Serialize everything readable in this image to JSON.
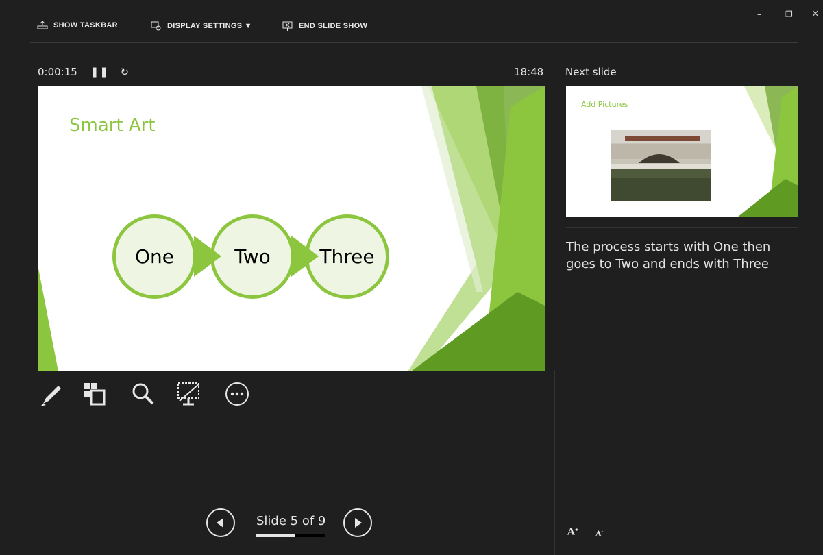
{
  "toolbar": {
    "show_taskbar": "SHOW TASKBAR",
    "display_settings": "DISPLAY SETTINGS ▼",
    "end_slide_show": "END SLIDE SHOW"
  },
  "window_controls": {
    "minimize": "–",
    "restore": "❐",
    "close": "×"
  },
  "timer": {
    "elapsed": "0:00:15",
    "clock": "18:48"
  },
  "current_slide": {
    "title": "Smart Art",
    "nodes": [
      "One",
      "Two",
      "Three"
    ],
    "accent_color": "#8cc63f"
  },
  "next_slide": {
    "label": "Next slide",
    "title": "Add Pictures"
  },
  "notes": "The process starts with One then goes to Two and ends with Three",
  "navigation": {
    "slide_text": "Slide 5 of 9",
    "current": 5,
    "total": 9,
    "progress_fraction": 0.56
  },
  "tools": [
    "pen-icon",
    "slides-grid-icon",
    "zoom-icon",
    "black-screen-icon",
    "more-options-icon"
  ],
  "font_controls": {
    "increase": "A",
    "decrease": "A"
  }
}
